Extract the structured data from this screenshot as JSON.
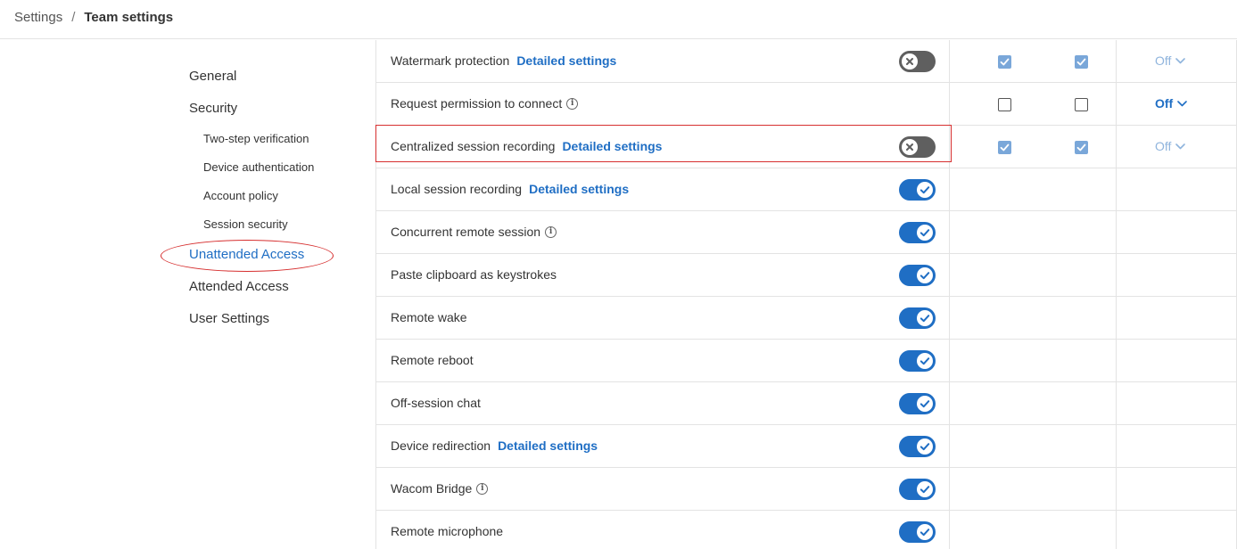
{
  "breadcrumb": {
    "root": "Settings",
    "separator": "/",
    "current": "Team settings"
  },
  "sidebar": {
    "items": [
      {
        "label": "General",
        "level": "top",
        "active": false
      },
      {
        "label": "Security",
        "level": "top",
        "active": false
      },
      {
        "label": "Two-step verification",
        "level": "sub",
        "active": false
      },
      {
        "label": "Device authentication",
        "level": "sub",
        "active": false
      },
      {
        "label": "Account policy",
        "level": "sub",
        "active": false
      },
      {
        "label": "Session security",
        "level": "sub",
        "active": false
      },
      {
        "label": "Unattended Access",
        "level": "top",
        "active": true
      },
      {
        "label": "Attended Access",
        "level": "top",
        "active": false
      },
      {
        "label": "User Settings",
        "level": "top",
        "active": false
      }
    ]
  },
  "detail_link_label": "Detailed settings",
  "info_icon": "i",
  "settings": [
    {
      "label": "Watermark protection",
      "detail": true,
      "info": false,
      "toggle": "off",
      "checkboxes": [
        "checked",
        "checked"
      ],
      "dropdown": {
        "value": "Off",
        "style": "muted"
      }
    },
    {
      "label": "Request permission to connect",
      "detail": false,
      "info": true,
      "toggle": null,
      "checkboxes": [
        "unchecked",
        "unchecked"
      ],
      "dropdown": {
        "value": "Off",
        "style": "strong"
      }
    },
    {
      "label": "Centralized session recording",
      "detail": true,
      "info": false,
      "toggle": "off",
      "checkboxes": [
        "checked",
        "checked"
      ],
      "dropdown": {
        "value": "Off",
        "style": "muted"
      },
      "highlighted": true
    },
    {
      "label": "Local session recording",
      "detail": true,
      "info": false,
      "toggle": "on"
    },
    {
      "label": "Concurrent remote session",
      "detail": false,
      "info": true,
      "toggle": "on"
    },
    {
      "label": "Paste clipboard as keystrokes",
      "detail": false,
      "info": false,
      "toggle": "on"
    },
    {
      "label": "Remote wake",
      "detail": false,
      "info": false,
      "toggle": "on"
    },
    {
      "label": "Remote reboot",
      "detail": false,
      "info": false,
      "toggle": "on"
    },
    {
      "label": "Off-session chat",
      "detail": false,
      "info": false,
      "toggle": "on"
    },
    {
      "label": "Device redirection",
      "detail": true,
      "info": false,
      "toggle": "on"
    },
    {
      "label": "Wacom Bridge",
      "detail": false,
      "info": true,
      "toggle": "on"
    },
    {
      "label": "Remote microphone",
      "detail": false,
      "info": false,
      "toggle": "on"
    }
  ],
  "colors": {
    "accent": "#1f6ec4",
    "toggle_off": "#5f5f5f",
    "checkbox_checked": "#7aa7d9",
    "annotation_red": "#d62f2f"
  }
}
